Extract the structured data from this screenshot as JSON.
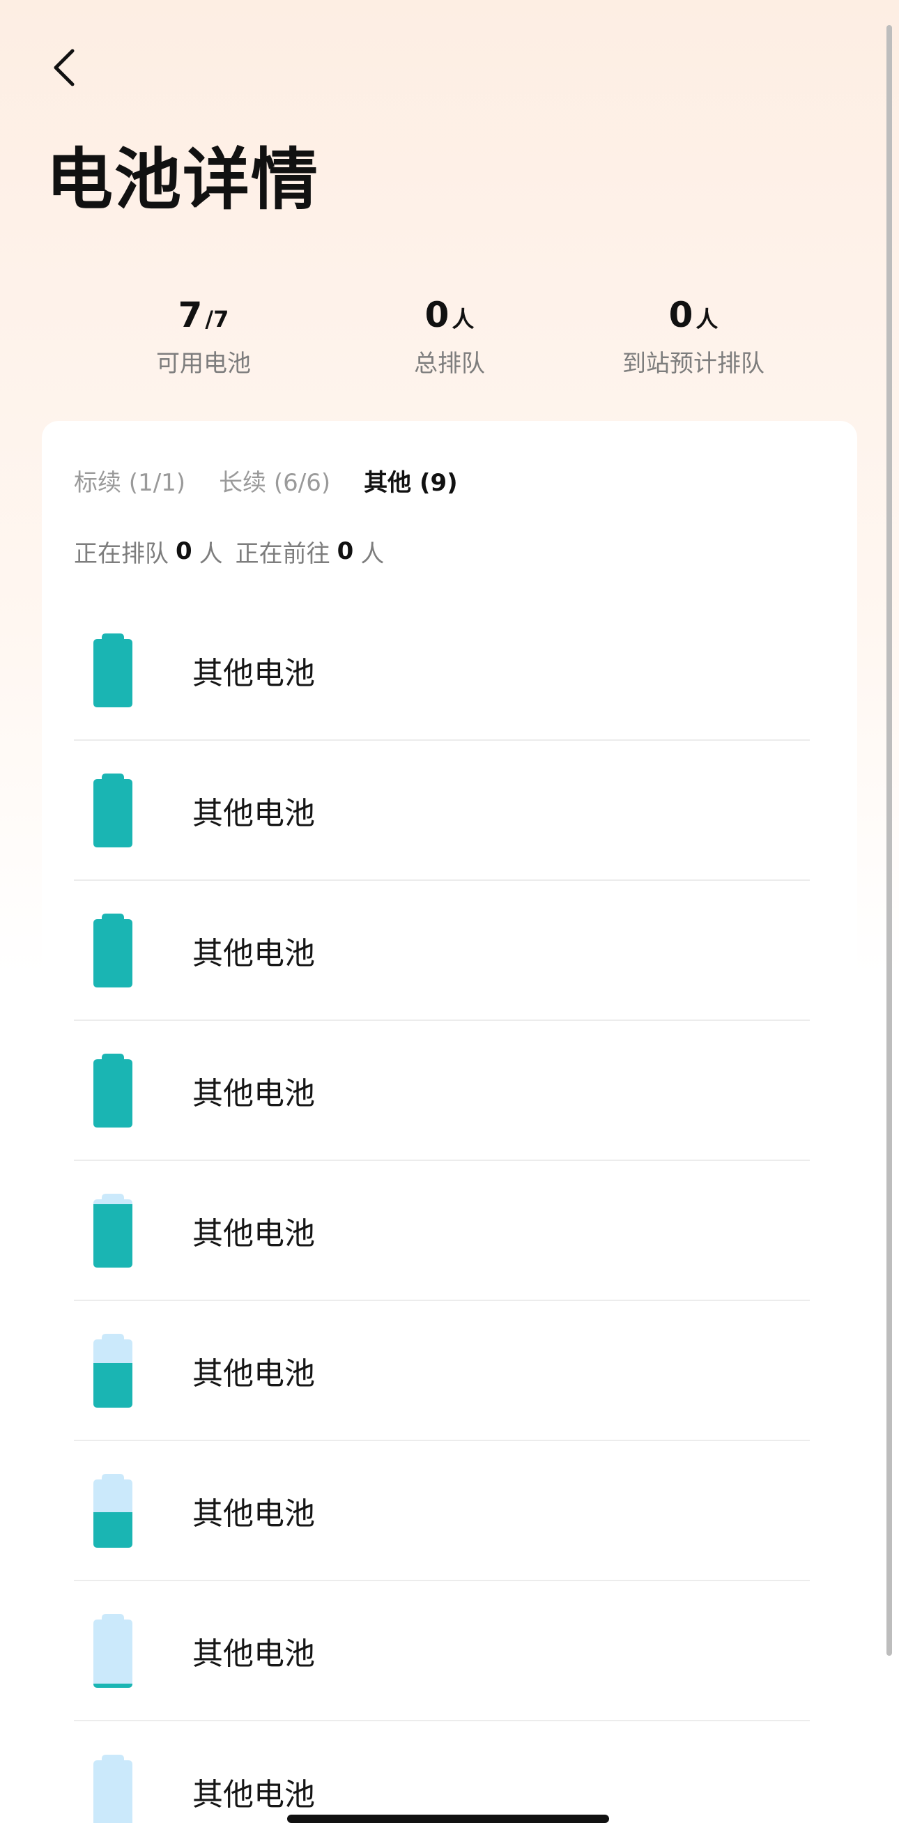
{
  "header": {
    "title": "电池详情"
  },
  "stats": [
    {
      "value": "7",
      "unit": "/7",
      "label": "可用电池"
    },
    {
      "value": "0",
      "unit": "人",
      "label": "总排队"
    },
    {
      "value": "0",
      "unit": "人",
      "label": "到站预计排队"
    }
  ],
  "tabs": [
    {
      "label": "标续 (1/1)",
      "active": false
    },
    {
      "label": "长续 (6/6)",
      "active": false
    },
    {
      "label": "其他 (9)",
      "active": true
    }
  ],
  "queue": {
    "queuing_label": "正在排队",
    "queuing_count": "0",
    "queuing_unit": "人",
    "heading_label": "正在前往",
    "heading_count": "0",
    "heading_unit": "人"
  },
  "colors": {
    "battery_fill": "#1ab5b3",
    "battery_empty": "#cbe9fb",
    "active_tab": "#111111",
    "inactive_tab": "#9a9a9a"
  },
  "batteries": [
    {
      "label": "其他电池",
      "charge": 1.0
    },
    {
      "label": "其他电池",
      "charge": 1.0
    },
    {
      "label": "其他电池",
      "charge": 1.0
    },
    {
      "label": "其他电池",
      "charge": 1.0
    },
    {
      "label": "其他电池",
      "charge": 0.86
    },
    {
      "label": "其他电池",
      "charge": 0.6
    },
    {
      "label": "其他电池",
      "charge": 0.48
    },
    {
      "label": "其他电池",
      "charge": 0.05
    },
    {
      "label": "其他电池",
      "charge": 0.0
    }
  ]
}
